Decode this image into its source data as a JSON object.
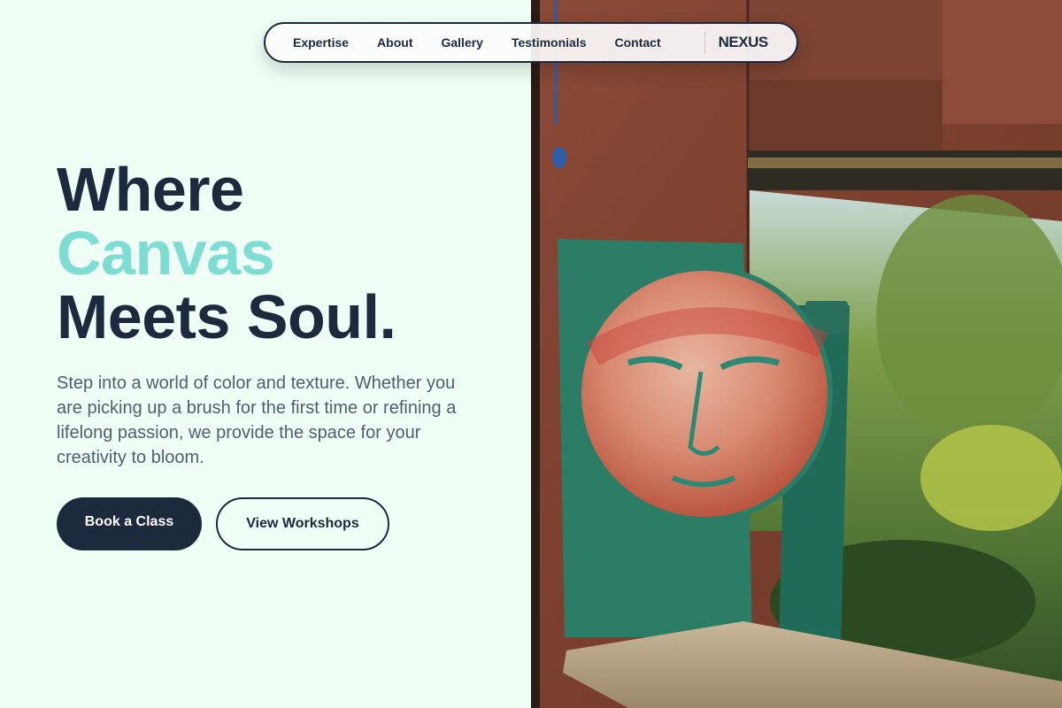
{
  "nav": {
    "links": [
      "Expertise",
      "About",
      "Gallery",
      "Testimonials",
      "Contact"
    ],
    "brand": "NEXUS"
  },
  "hero": {
    "title_line1": "Where",
    "title_line2": "Canvas",
    "title_line3": "Meets Soul.",
    "description": "Step into a world of color and texture. Whether you are picking up a brush for the first time or refining a lifelong passion, we provide the space for your creativity to bloom.",
    "primary_button": "Book a Class",
    "secondary_button": "View Workshops"
  },
  "colors": {
    "background": "#effff6",
    "ink": "#1d2a3d",
    "accent": "#7dddd2",
    "body_text": "#4f5f70"
  },
  "image": {
    "semantic": "painted-face-artwork-photo"
  }
}
